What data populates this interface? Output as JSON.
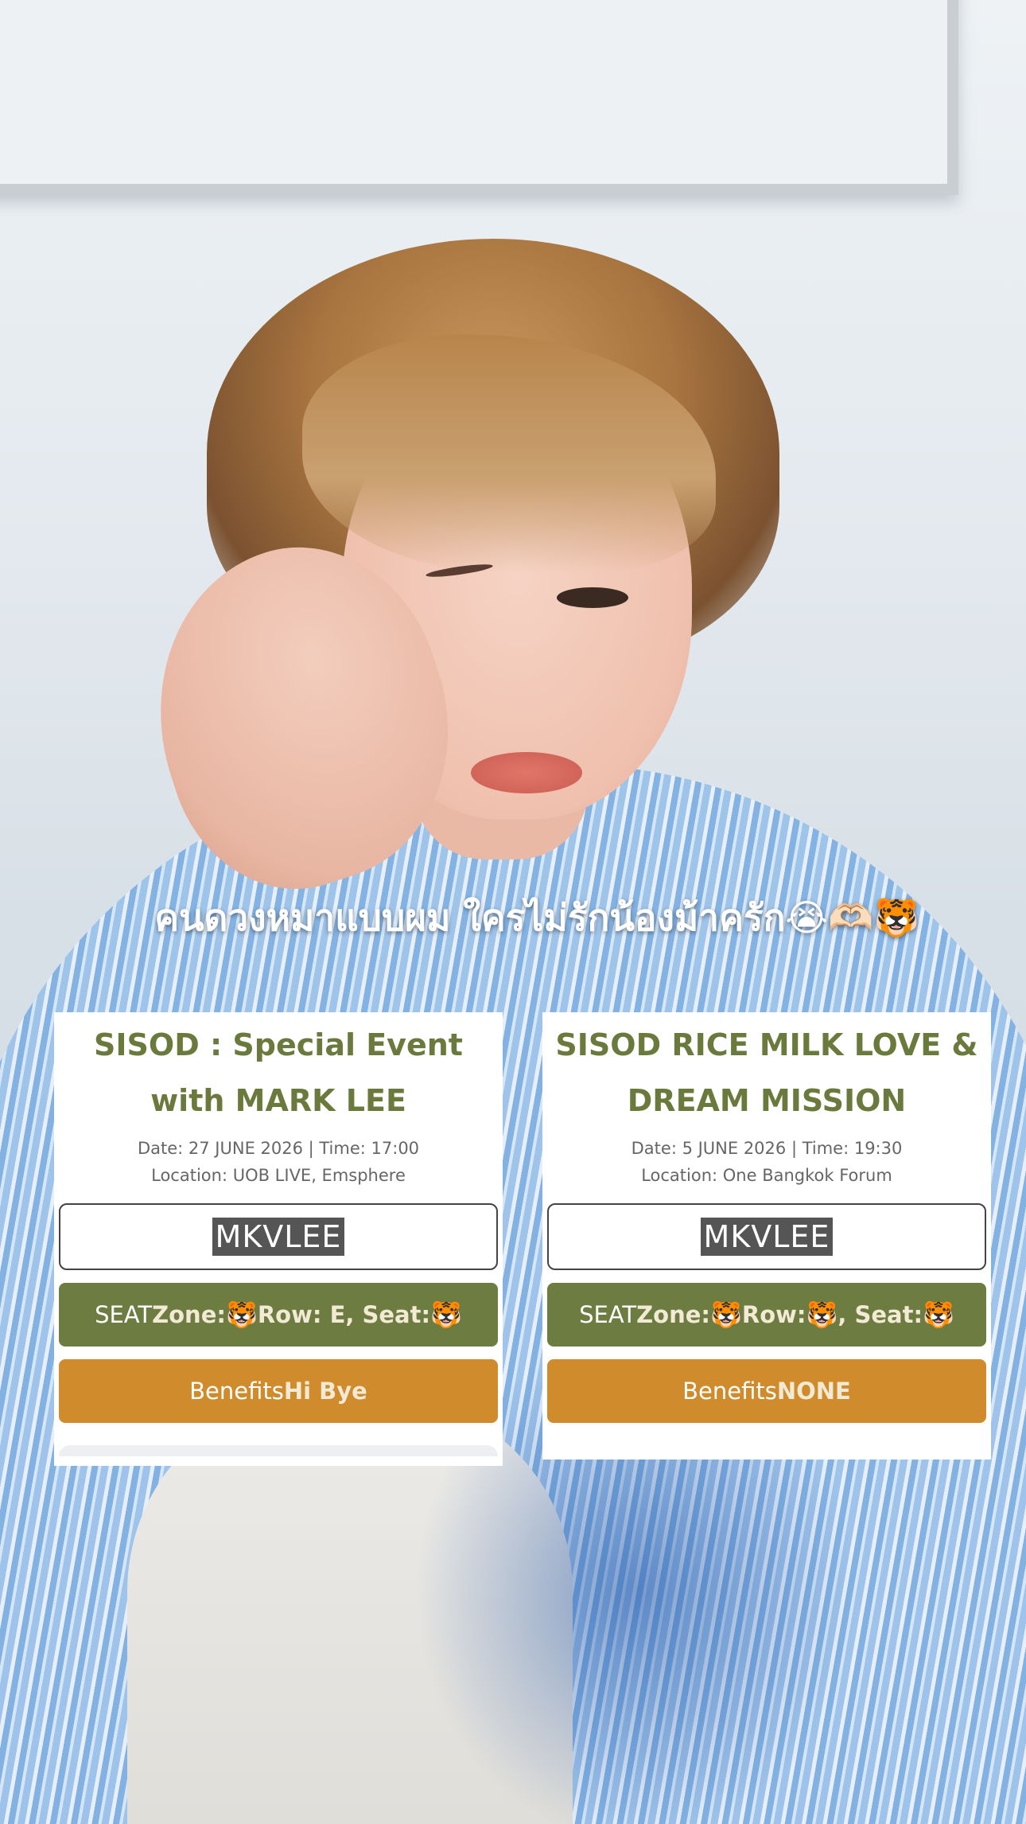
{
  "caption": {
    "text": "คนดวงหมาแบบผม  ใครไม่รักน้องม้าครัก😭🫶🏻🐯"
  },
  "tickets": [
    {
      "title_line1": "SISOD : Special Event",
      "title_line2": "with MARK LEE",
      "date_line": "Date: 27 JUNE 2026 | Time: 17:00",
      "location_line": "Location: UOB LIVE, Emsphere",
      "name": "MKVLEE",
      "seat_prefix": "SEAT ",
      "seat_zone_label": "Zone:",
      "seat_zone_value": "🐯",
      "seat_row_label": "Row: E, Seat:",
      "seat_row_value": "",
      "seat_seat_label": "",
      "seat_seat_value": "🐯",
      "benefits_prefix": "Benefits ",
      "benefits_value": "Hi Bye"
    },
    {
      "title_line1": "SISOD RICE MILK LOVE &",
      "title_line2": "DREAM MISSION",
      "date_line": "Date: 5 JUNE 2026 | Time: 19:30",
      "location_line": "Location: One Bangkok Forum",
      "name": "MKVLEE",
      "seat_prefix": "SEAT ",
      "seat_zone_label": "Zone:",
      "seat_zone_value": "🐯",
      "seat_row_label": "Row: ",
      "seat_row_value": "🐯",
      "seat_seat_label": ", Seat:",
      "seat_seat_value": "🐯",
      "benefits_prefix": "Benefits ",
      "benefits_value": "NONE"
    }
  ],
  "colors": {
    "title_green": "#6a7a3d",
    "seat_bar": "#6d7c40",
    "benefit_bar": "#d08b2c"
  }
}
